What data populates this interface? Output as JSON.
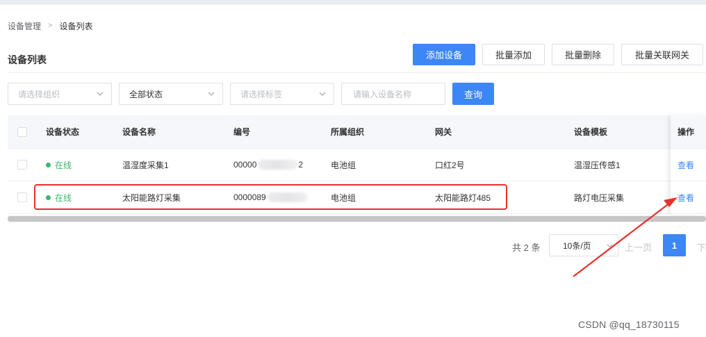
{
  "breadcrumb": {
    "parent": "设备管理",
    "separator": ">",
    "current": "设备列表"
  },
  "page_title": "设备列表",
  "toolbar": {
    "add_device": "添加设备",
    "batch_add": "批量添加",
    "batch_delete": "批量删除",
    "batch_link_gateway": "批量关联网关"
  },
  "filters": {
    "org_placeholder": "请选择组织",
    "status_value": "全部状态",
    "tag_placeholder": "请选择标签",
    "name_placeholder": "请输入设备名称",
    "query_button": "查询"
  },
  "table": {
    "headers": {
      "status": "设备状态",
      "name": "设备名称",
      "code": "编号",
      "org": "所属组织",
      "gateway": "网关",
      "template": "设备模板",
      "action": "操作"
    },
    "rows": [
      {
        "status": "在线",
        "name": "温湿度采集1",
        "code": "00000",
        "code_tail": "2",
        "org": "电池组",
        "gateway": "口红2号",
        "template": "温湿压传感1",
        "action": "查看"
      },
      {
        "status": "在线",
        "name": "太阳能路灯采集",
        "code": "0000089",
        "code_tail": "",
        "org": "电池组",
        "gateway": "太阳能路灯485",
        "template": "路灯电压采集",
        "action": "查看"
      }
    ]
  },
  "pagination": {
    "total": "共 2 条",
    "page_size": "10条/页",
    "prev": "上一页",
    "current": "1",
    "next": "下"
  },
  "colors": {
    "primary": "#3d86f5",
    "online": "#3cb46e",
    "annotation": "#e8302a"
  },
  "icons": [
    "chevron-right-icon",
    "chevron-down-icon",
    "status-dot-icon",
    "annotation-arrow-icon"
  ],
  "watermark": "CSDN @qq_18730115"
}
